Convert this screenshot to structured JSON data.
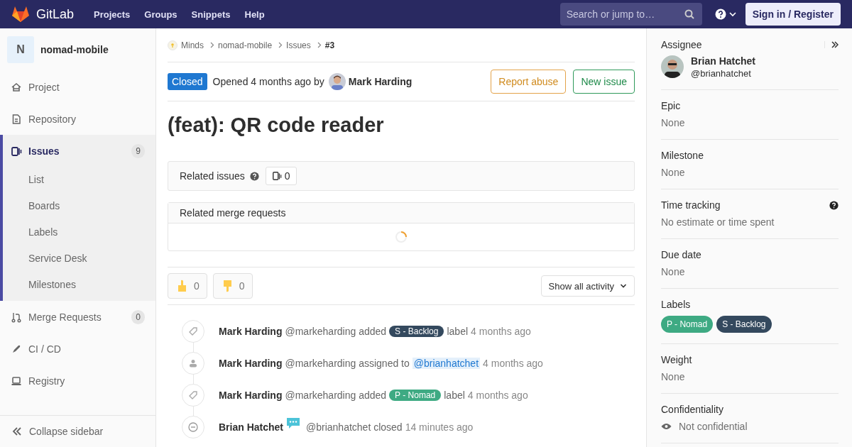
{
  "topbar": {
    "brand": "GitLab",
    "nav": [
      "Projects",
      "Groups",
      "Snippets",
      "Help"
    ],
    "search": {
      "placeholder": "Search or jump to…"
    },
    "signin": "Sign in / Register"
  },
  "sidebar": {
    "project": {
      "initial": "N",
      "name": "nomad-mobile"
    },
    "items": [
      {
        "kind": "project",
        "label": "Project",
        "selected": false
      },
      {
        "kind": "repository",
        "label": "Repository",
        "selected": false
      },
      {
        "kind": "issues",
        "label": "Issues",
        "count": "9",
        "selected": true,
        "children": [
          {
            "label": "List"
          },
          {
            "label": "Boards"
          },
          {
            "label": "Labels"
          },
          {
            "label": "Service Desk"
          },
          {
            "label": "Milestones"
          }
        ]
      },
      {
        "kind": "merge",
        "label": "Merge Requests",
        "count": "0",
        "selected": false
      },
      {
        "kind": "cicd",
        "label": "CI / CD",
        "selected": false
      },
      {
        "kind": "registry",
        "label": "Registry",
        "selected": false
      }
    ],
    "collapse": "Collapse sidebar"
  },
  "breadcrumb": [
    "Minds",
    "nomad-mobile",
    "Issues",
    "#3"
  ],
  "issue": {
    "status": "Closed",
    "opened": "Opened 4 months ago by",
    "author": "Mark Harding",
    "buttons": [
      {
        "kind": "abuse",
        "label": "Report abuse"
      },
      {
        "kind": "new",
        "label": "New issue"
      }
    ],
    "title": "(feat): QR code reader"
  },
  "related_issues": {
    "title": "Related issues",
    "count": "0"
  },
  "related_merge_requests": {
    "title": "Related merge requests",
    "loading": true
  },
  "awards": [
    {
      "kind": "up",
      "count": "0"
    },
    {
      "kind": "down",
      "count": "0"
    }
  ],
  "activity_filter": "Show all activity",
  "activity": [
    {
      "kind": "label",
      "author": "Mark Harding",
      "action": "@markeharding added",
      "label": {
        "text": "S - Backlog",
        "color": "#34495e"
      },
      "after": "label",
      "time": "4 months ago"
    },
    {
      "kind": "assign",
      "author": "Mark Harding",
      "action": "@markeharding assigned to",
      "mention": "@brianhatchet",
      "time": "4 months ago"
    },
    {
      "kind": "label",
      "author": "Mark Harding",
      "action": "@markeharding added",
      "label": {
        "text": "P - Nomad",
        "color": "#3eaa83"
      },
      "after": "label",
      "time": "4 months ago"
    },
    {
      "kind": "close",
      "author": "Brian Hatchet",
      "note_icon": true,
      "action": "@brianhatchet closed",
      "time": "14 minutes ago"
    }
  ],
  "right_sidebar": {
    "assignee": {
      "title": "Assignee",
      "name": "Brian Hatchet",
      "handle": "@brianhatchet"
    },
    "sections": [
      {
        "kind": "text",
        "title": "Epic",
        "value": "None"
      },
      {
        "kind": "text",
        "title": "Milestone",
        "value": "None"
      },
      {
        "kind": "text",
        "title": "Time tracking",
        "value": "No estimate or time spent",
        "help": true
      },
      {
        "kind": "text",
        "title": "Due date",
        "value": "None"
      },
      {
        "kind": "labels",
        "title": "Labels",
        "labels": [
          {
            "text": "P - Nomad",
            "color": "#3eaa83"
          },
          {
            "text": "S - Backlog",
            "color": "#34495e"
          }
        ]
      },
      {
        "kind": "text",
        "title": "Weight",
        "value": "None"
      },
      {
        "kind": "confidential",
        "title": "Confidentiality",
        "value": "Not confidential"
      }
    ]
  }
}
